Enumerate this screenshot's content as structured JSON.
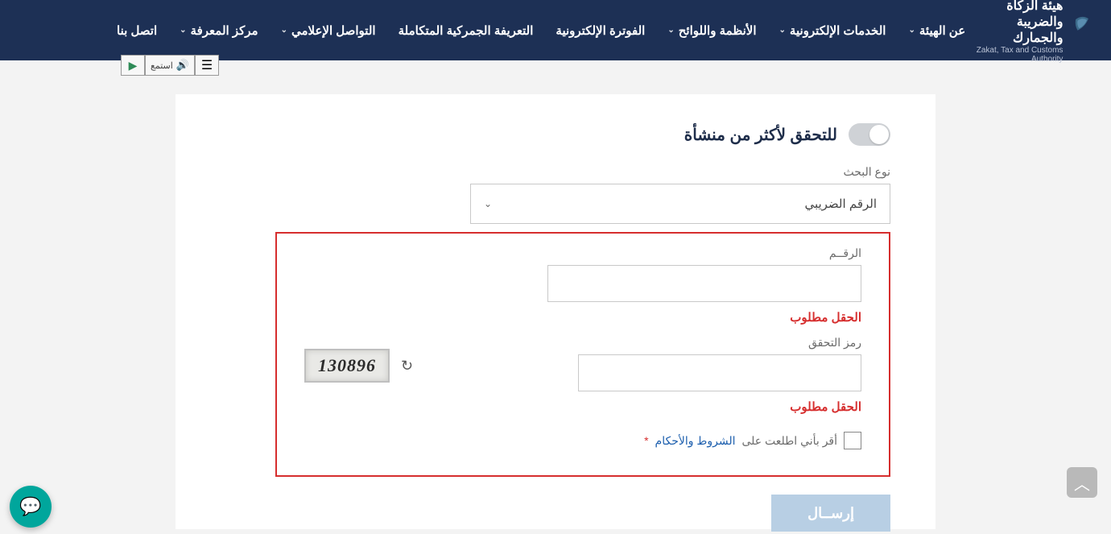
{
  "brand": {
    "ar": "هيئة الزكاة والضريبة والجمارك",
    "en": "Zakat, Tax and Customs Authority"
  },
  "nav": {
    "about": "عن الهيئة",
    "eservices": "الخدمات الإلكترونية",
    "regulations": "الأنظمة واللوائح",
    "einvoicing": "الفوترة الإلكترونية",
    "tariff": "التعريفة الجمركية المتكاملة",
    "media": "التواصل الإعلامي",
    "knowledge": "مركز المعرفة",
    "contact": "اتصل بنا"
  },
  "listen": {
    "label": "استمع"
  },
  "form": {
    "toggle_label": "للتحقق لأكثر من منشأة",
    "search_type_label": "نوع البحث",
    "search_type_value": "الرقم الضريبي",
    "number_label": "الرقــم",
    "captcha_label": "رمز التحقق",
    "required_msg": "الحقل مطلوب",
    "captcha_value": "130896",
    "terms_prefix": "أقر بأني اطلعت على",
    "terms_link": "الشروط والأحكام",
    "asterisk": "*",
    "submit": "إرســال"
  }
}
